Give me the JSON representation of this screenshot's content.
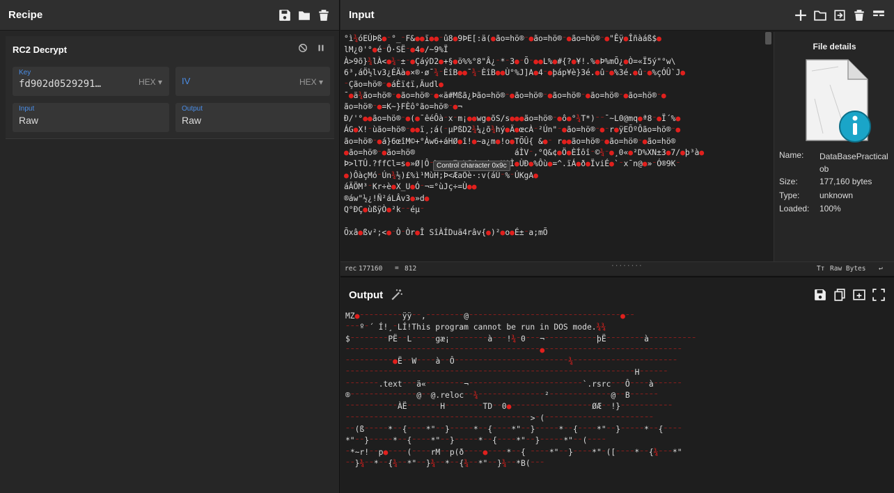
{
  "recipe": {
    "title": "Recipe",
    "operation": {
      "name": "RC2 Decrypt",
      "key": {
        "label": "Key",
        "value": "fd902d0529291…",
        "format": "HEX ▾"
      },
      "iv": {
        "label": "IV",
        "value": "",
        "format": "HEX ▾"
      },
      "input": {
        "label": "Input",
        "value": "Raw"
      },
      "output": {
        "label": "Output",
        "value": "Raw"
      }
    }
  },
  "input": {
    "title": "Input",
    "lines": [
      "°ì¾óEÚÞß●⁻°_⁻F&●●ï●●⁻û8●9ÞE[:ä(●ão=hö®⁻●ão=hö®⁻●ão=hö®⁻●\"Êÿ●Îñàáß$●",
      "lM¿0'°●é⁻Ô·SË⁻●4●/~9%Ï",
      "À>9õ}¾lÀ<●¾⁻±⁻●ÇáýD2●+§●ö%%°8\"Â¿⁻*⁻3●⁻Õ⁻●●L%●#{?●¥!.%●Þ%mÕ¿●Ò=«Ï5ý\"°w\\",
      "6³,áÖ½lv3¿ÉÄà●×®·ø¯¾⁻ÈîB●●¯¾⁻ÈîB●●Ù°%J]A●4⁻●þáp¥è}3é.●û⁻●%3é.●û⁻●%çÓÛ`J●",
      "⁻Ção=hö®⁻●áÈï¢ï,Äudl●",
      "¯●ä¾ão=hö®⁻●ão=hö®⁻●«ä#Mßã¿Þão=hö®⁻●ão=hö®⁻●ão=hö®⁻●ão=hö®⁻●ão=hö®⁻●",
      "ão=hö®⁻●=K~}FÈô°ão=hö®⁻●¬",
      "Ð/'°●●ão=hö®⁻●(●¯êéÔà⁻x⁻m¡●●wg●õS/s●●●ão=hö®⁻●ô●°¾T*)⁻⁻¯~L0@mq●ª8⁻●Ï´%●",
      "ÁG●X!⁻ùão=hö®⁻●●ï¸;á(⁻µPßD2¾¼¿õ¾hý●Ä●œcÀ⁻²Ún\"⁻●ão=hö®⁻●⁻r●ÿEÕºÔão=hö®⁻●",
      "ão=hö®⁻●á}6œîM©+°Àw6+áHØ●î!●~a¿m●!o●TÕÛ{ &●⁻ r●●ão=hö®⁻●ão=hö®⁻●ão=hö®",
      "●ão=hö®⁻●ão=hö®                     áÌV⁻,°Q&¢●Ö●ÈÍôî⁻©¾⁻●¸0«●²D%XN±3●7/●þ³à●",
      "Þ>lTÛ.?ffCl=s●»Ø|Ô⁻þ⁻●●7⁻L¶d●●i¿⁻UAÌ●ÙÐ●%Ôù●=^.ïÁ●ð●ÏviÉ●`⁻x¯n@●»⁻Ó®9K⁻",
      "●)ÔàçMó⁻Ún¾½)£%ì¹MùH;Þ<ÆaÔè·:v(áÚ⁻%⁻ÚKgA●",
      "áÄÖM³⁻Kr÷è●X_U●Ó⁻¬=°ùJç÷=Ù●●",
      "®áw\"½¿!Ñ²áLÂv3●»d●",
      "Q°ÐÇ●ùßÿÒ●²k⁻⁻éµ⁻",
      "",
      "Õxâ●ßv²;<●⁻Ò⁻Òr●Î SîÀÍDuä4râv{●)²●o●É±⁻a;mÕ"
    ],
    "tooltip": "Control character 0x9c",
    "status": {
      "length": "177160",
      "lines": "812",
      "raw_bytes": "Raw Bytes"
    },
    "file_details": {
      "title": "File details",
      "name_label": "Name:",
      "name_value": "DataBasePracticalob",
      "size_label": "Size:",
      "size_value": "177,160 bytes",
      "type_label": "Type:",
      "type_value": "unknown",
      "loaded_label": "Loaded:",
      "loaded_value": "100%"
    }
  },
  "output": {
    "title": "Output",
    "lines": [
      "MZ●⁻⁻⁻⁻⁻⁻⁻⁻⁻ÿÿ⁻⁻,⁻⁻⁻⁻⁻⁻⁻⁻@⁻⁻⁻⁻⁻⁻⁻⁻⁻⁻⁻⁻⁻⁻⁻⁻⁻⁻⁻⁻⁻⁻⁻⁻⁻⁻⁻⁻⁻⁻⁻⁻●⁻⁻",
      "⁻⁻⁻º⁻´ Í!¸⁻LÍ!This program cannot be run in DOS mode.¾¾",
      "$⁻⁻⁻⁻⁻⁻⁻⁻PË⁻⁻L⁻⁻⁻⁻⁻gæ¡⁻⁻⁻⁻⁻⁻⁻⁻à⁻⁻⁻!¾⁻0⁻⁻⁻¬⁻⁻⁻⁻⁻⁻⁻⁻⁻⁻⁻þË⁻⁻⁻⁻⁻⁻⁻⁻à⁻⁻⁻⁻⁻⁻⁻⁻⁻⁻",
      "⁻⁻⁻⁻⁻⁻⁻⁻⁻⁻⁻⁻⁻⁻⁻⁻⁻⁻⁻⁻⁻⁻⁻⁻⁻⁻⁻⁻⁻⁻⁻⁻⁻⁻⁻⁻⁻⁻⁻⁻⁻●⁻⁻⁻⁻⁻⁻⁻⁻⁻⁻⁻⁻⁻⁻⁻⁻⁻⁻⁻⁻⁻⁻⁻⁻⁻⁻⁻⁻⁻",
      "⁻⁻⁻⁻⁻⁻⁻⁻⁻⁻●Ë⁻⁻W⁻⁻⁻⁻à⁻⁻Ô⁻⁻⁻⁻⁻⁻⁻⁻⁻⁻⁻⁻⁻⁻⁻⁻⁻⁻⁻⁻⁻⁻⁻⁻¾⁻⁻⁻⁻⁻⁻⁻⁻⁻⁻⁻⁻⁻⁻⁻⁻⁻⁻⁻⁻⁻⁻",
      "⁻⁻⁻⁻⁻⁻⁻⁻⁻⁻⁻⁻⁻⁻⁻⁻⁻⁻⁻⁻⁻⁻⁻⁻⁻⁻⁻⁻⁻⁻⁻⁻⁻⁻⁻⁻⁻⁻⁻⁻⁻⁻⁻⁻⁻⁻⁻⁻⁻⁻⁻⁻⁻⁻⁻⁻⁻⁻⁻⁻⁻H⁻⁻⁻⁻⁻⁻",
      "⁻⁻⁻⁻⁻⁻⁻.text⁻⁻⁻ä«⁻⁻⁻⁻⁻⁻⁻⁻¬⁻⁻⁻⁻⁻⁻⁻⁻⁻⁻⁻⁻⁻⁻⁻⁻⁻⁻⁻⁻⁻⁻⁻⁻`.rsrc⁻⁻⁻Ô⁻⁻⁻⁻à⁻⁻⁻⁻⁻⁻",
      "®⁻⁻⁻⁻⁻⁻⁻⁻⁻⁻⁻⁻⁻⁻@⁻⁻@.reloc⁻⁻¾⁻⁻⁻⁻⁻⁻⁻⁻⁻⁻⁻⁻⁻⁻²⁻⁻⁻⁻⁻⁻⁻⁻⁻⁻⁻⁻⁻@⁻⁻B⁻⁻⁻⁻⁻⁻",
      "⁻⁻⁻⁻⁻⁻⁻⁻⁻⁻⁻ÀË⁻⁻⁻⁻⁻⁻⁻H⁻⁻⁻⁻⁻⁻⁻⁻TD⁻⁻0●⁻⁻⁻⁻⁻⁻⁻⁻⁻⁻⁻⁻⁻⁻⁻⁻⁻ØÆ⁻⁻!}⁻⁻⁻⁻⁻⁻⁻⁻⁻⁻⁻",
      "⁻⁻⁻⁻⁻⁻⁻⁻⁻⁻⁻⁻⁻⁻⁻⁻⁻⁻⁻⁻⁻⁻⁻⁻⁻⁻⁻⁻⁻⁻⁻⁻⁻⁻⁻⁻⁻⁻⁻>⁻(⁻⁻⁻⁻⁻⁻⁻⁻⁻⁻⁻⁻⁻⁻⁻⁻⁻⁻⁻⁻⁻⁻⁻",
      "⁻⁻(ß⁻⁻⁻⁻⁻*⁻⁻{⁻⁻⁻⁻*\"⁻⁻}⁻⁻⁻⁻⁻*⁻⁻{⁻⁻⁻⁻*\"⁻⁻}⁻⁻⁻⁻⁻*⁻⁻{⁻⁻⁻⁻*\"⁻⁻}⁻⁻⁻⁻⁻*⁻⁻{⁻⁻⁻⁻",
      "*\"⁻⁻}⁻⁻⁻⁻⁻*⁻⁻{⁻⁻⁻⁻*\"⁻⁻}⁻⁻⁻⁻⁻*⁻⁻{⁻⁻⁻⁻*\"⁻⁻}⁻⁻⁻⁻⁻*\"⁻⁻(⁻⁻⁻⁻",
      "⁻*~r!⁻⁻p●⁻⁻⁻⁻(⁻⁻⁻⁻rM⁻⁻p(ð⁻⁻⁻⁻●⁻⁻⁻⁻*⁻⁻{ ⁻⁻⁻⁻*\"⁻⁻}⁻⁻⁻⁻*\"⁻([⁻⁻⁻⁻*⁻⁻{¾⁻⁻⁻*\"",
      "⁻⁻}¾⁻⁻*⁻⁻{¾⁻⁻*\"⁻⁻}¾⁻⁻*⁻⁻{¾⁻⁻*\"⁻⁻}¾⁻⁻*B(⁻⁻⁻"
    ]
  }
}
